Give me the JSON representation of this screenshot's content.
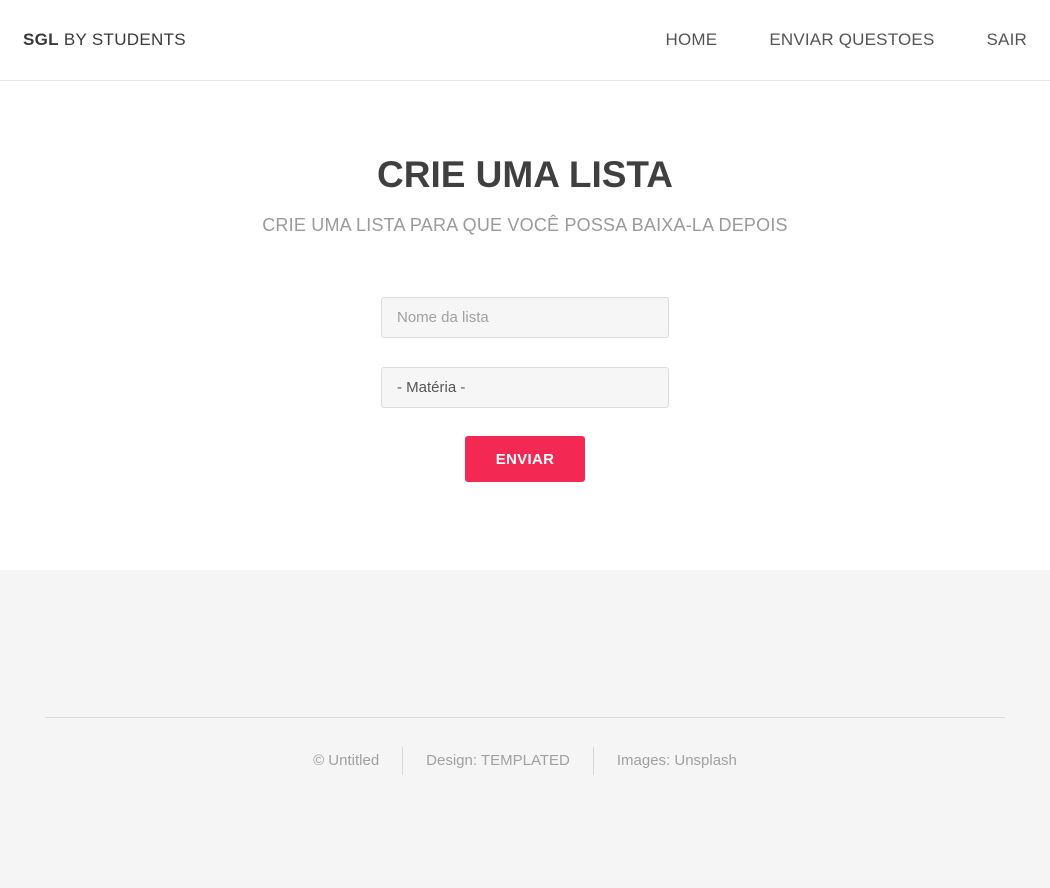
{
  "header": {
    "logo_bold": "SGL",
    "logo_rest": " BY STUDENTS",
    "nav": [
      {
        "label": "HOME"
      },
      {
        "label": "ENVIAR QUESTOES"
      },
      {
        "label": "SAIR"
      }
    ]
  },
  "main": {
    "title": "CRIE UMA LISTA",
    "subtitle": "CRIE UMA LISTA PARA QUE VOCÊ POSSA BAIXA-LA DEPOIS",
    "name_field": {
      "placeholder": "Nome da lista",
      "value": ""
    },
    "subject_select": {
      "selected": "- Matéria -"
    },
    "submit_label": "ENVIAR"
  },
  "footer": {
    "credits": [
      "© Untitled",
      "Design: TEMPLATED",
      "Images: Unsplash"
    ]
  },
  "colors": {
    "accent": "#f32853",
    "footer_bg": "#f5f5f5"
  }
}
